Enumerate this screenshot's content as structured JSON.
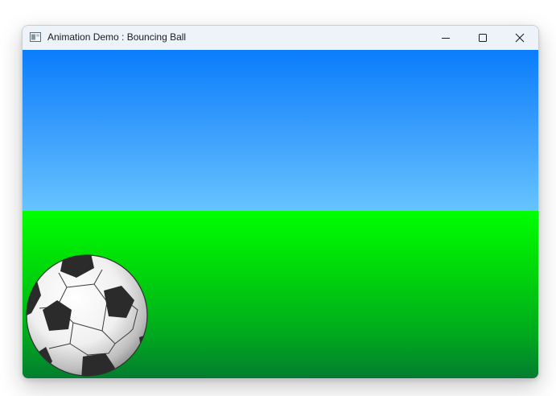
{
  "window": {
    "title": "Animation Demo : Bouncing Ball",
    "app_icon": "window-app-icon",
    "controls": {
      "minimize_icon": "minimize-icon",
      "maximize_icon": "maximize-icon",
      "close_icon": "close-icon"
    }
  },
  "scene": {
    "sky_colors": [
      "#0a7dfc",
      "#66c4fe"
    ],
    "grass_colors": [
      "#00ff00",
      "#037d30"
    ],
    "ball": {
      "type": "soccer-ball",
      "colors": [
        "#ffffff",
        "#2b2b2b"
      ]
    }
  }
}
